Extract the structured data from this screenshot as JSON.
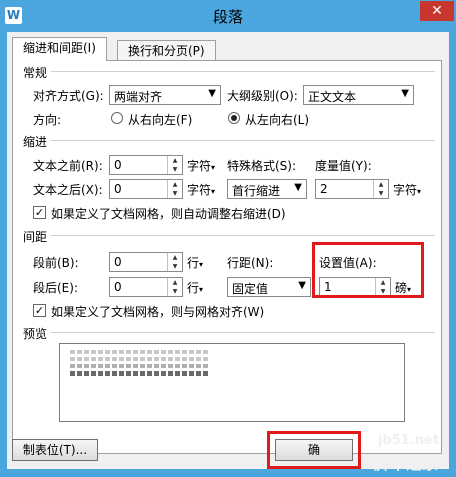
{
  "window": {
    "title": "段落",
    "logo": "W",
    "close_glyph": "✕"
  },
  "tabs": [
    {
      "label": "缩进和间距(I)",
      "active": true
    },
    {
      "label": "换行和分页(P)",
      "active": false
    }
  ],
  "general": {
    "title": "常规",
    "alignment_label": "对齐方式(G):",
    "alignment_value": "两端对齐",
    "outline_label": "大纲级别(O):",
    "outline_value": "正文文本",
    "direction_label": "方向:",
    "direction_rtl": "从右向左(F)",
    "direction_ltr": "从左向右(L)",
    "direction_selected": "ltr"
  },
  "indent": {
    "title": "缩进",
    "before_label": "文本之前(R):",
    "before_value": "0",
    "before_unit": "字符",
    "after_label": "文本之后(X):",
    "after_value": "0",
    "after_unit": "字符",
    "special_label": "特殊格式(S):",
    "special_value": "首行缩进",
    "measure_label": "度量值(Y):",
    "measure_value": "2",
    "measure_unit": "字符",
    "grid_check_label": "如果定义了文档网格，则自动调整右缩进(D)",
    "grid_checked": true
  },
  "spacing": {
    "title": "间距",
    "before_label": "段前(B):",
    "before_value": "0",
    "before_unit": "行",
    "after_label": "段后(E):",
    "after_value": "0",
    "after_unit": "行",
    "line_label": "行距(N):",
    "line_value": "固定值",
    "set_label": "设置值(A):",
    "set_value": "1",
    "set_unit": "磅",
    "grid_check_label": "如果定义了文档网格，则与网格对齐(W)",
    "grid_checked": true
  },
  "preview": {
    "title": "预览"
  },
  "buttons": {
    "tabs": "制表位(T)...",
    "ok": "确"
  },
  "watermark": {
    "site": "jb51.net",
    "cn": "脚本之家"
  },
  "colors": {
    "titlebar": "#4aa6dd",
    "highlight": "#e0191c",
    "close": "#c7372f"
  }
}
